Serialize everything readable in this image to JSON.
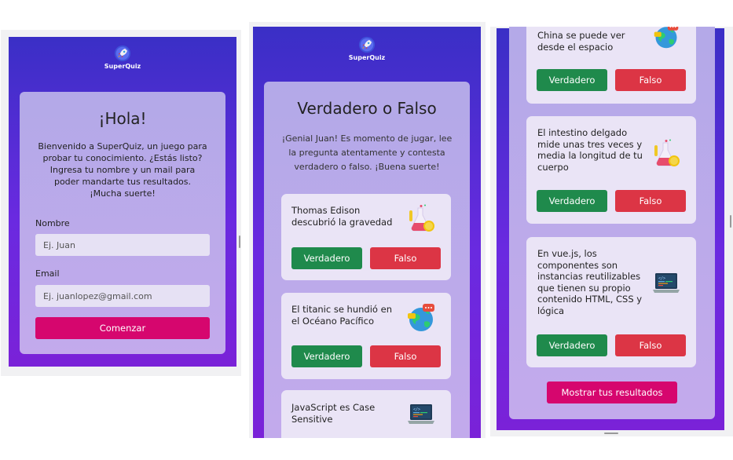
{
  "app": {
    "name": "SuperQuiz"
  },
  "welcome": {
    "title": "¡Hola!",
    "intro": "Bienvenido a SuperQuiz, un juego para probar tu conocimiento. ¿Estás listo? Ingresa tu nombre y un mail para poder mandarte tus resultados. ¡Mucha suerte!",
    "name_label": "Nombre",
    "name_placeholder": "Ej. Juan",
    "email_label": "Email",
    "email_placeholder": "Ej. juanlopez@gmail.com",
    "start_button": "Comenzar"
  },
  "quiz": {
    "title": "Verdadero o Falso",
    "intro": "¡Genial Juan! Es momento de jugar, lee la pregunta atentamente y contesta verdadero o falso. ¡Buena suerte!",
    "true_label": "Verdadero",
    "false_label": "Falso",
    "questions": [
      {
        "text": "Thomas Edison descubrió la gravedad",
        "icon": "chemistry-flask-icon"
      },
      {
        "text": "El titanic se hundió en el Océano Pacífico",
        "icon": "globe-icon"
      },
      {
        "text": "JavaScript es Case Sensitive",
        "icon": "laptop-code-icon"
      },
      {
        "text": "China se puede ver desde el espacio",
        "icon": "globe-icon"
      },
      {
        "text": "El intestino delgado mide unas tres veces y media la longitud de tu cuerpo",
        "icon": "chemistry-flask-icon"
      },
      {
        "text": "En vue.js, los componentes son instancias reutilizables que tienen su propio contenido HTML, CSS y lógica",
        "icon": "laptop-code-icon"
      }
    ],
    "results_button": "Mostrar tus resultados"
  },
  "colors": {
    "true": "#1f8a4c",
    "false": "#dc3545",
    "primary": "#d6066e",
    "background_top": "#3a2fc6",
    "background_bottom": "#7a22d8"
  }
}
